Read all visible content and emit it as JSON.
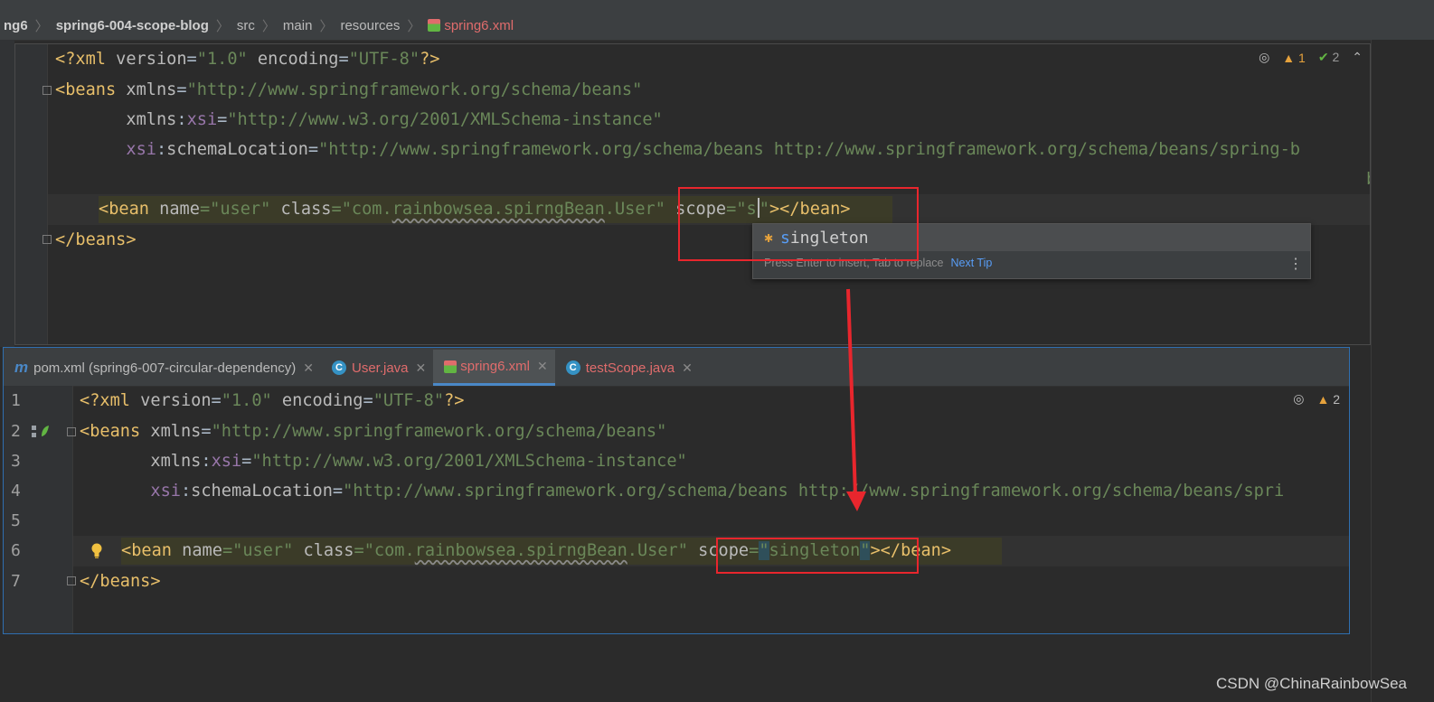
{
  "breadcrumb": {
    "items": [
      "ng6",
      "spring6-004-scope-blog",
      "src",
      "main",
      "resources",
      "spring6.xml"
    ]
  },
  "top_editor": {
    "lines": {
      "l1": {
        "pi_open": "<?xml ",
        "a1": "version",
        "eq1": "=",
        "v1": "\"1.0\"",
        "a2": " encoding",
        "eq2": "=",
        "v2": "\"UTF-8\"",
        "pi_close": "?>"
      },
      "l2": {
        "tag": "<beans ",
        "attr": "xmlns",
        "eq": "=",
        "val": "\"http://www.springframework.org/schema/beans\""
      },
      "l3": {
        "indent": "       ",
        "attr": "xmlns",
        "colon": ":",
        "ns": "xsi",
        "eq": "=",
        "val": "\"http://www.w3.org/2001/XMLSchema-instance\""
      },
      "l4": {
        "indent": "       ",
        "ns": "xsi",
        "colon": ":",
        "attr": "schemaLocation",
        "eq": "=",
        "val": "\"http://www.springframework.org/schema/beans http://www.springframework.org/schema/beans/spring-b"
      },
      "l6": {
        "tag": "<bean ",
        "a1": "name",
        "eq1": "=",
        "v1": "\"user\"",
        "a2": " class",
        "eq2": "=",
        "v2_pre": "\"com.",
        "v2_sq": "rainbowsea.spirngBean",
        "v2_post": ".User\"",
        "a3": " scope",
        "eq3": "=",
        "v3_open": "\"",
        "v3": "s",
        "v3_close": "\"",
        "close": "></bean>"
      },
      "l7": {
        "tag": "</beans>"
      }
    },
    "overflow_text": "bean",
    "status": {
      "warnings": "1",
      "checks": "2"
    }
  },
  "completion": {
    "match": "s",
    "rest": "ingleton",
    "hint": "Press Enter to insert, Tab to replace",
    "next_tip": "Next Tip"
  },
  "bottom_editor": {
    "tabs": [
      {
        "label": "pom.xml (spring6-007-circular-dependency)",
        "icon": "maven-icon"
      },
      {
        "label": "User.java",
        "icon": "class-icon"
      },
      {
        "label": "spring6.xml",
        "icon": "xml-file-icon"
      },
      {
        "label": "testScope.java",
        "icon": "class-icon"
      }
    ],
    "line_numbers": [
      "1",
      "2",
      "3",
      "4",
      "5",
      "6",
      "7"
    ],
    "lines": {
      "l1": {
        "pi_open": "<?xml ",
        "a1": "version",
        "eq1": "=",
        "v1": "\"1.0\"",
        "a2": " encoding",
        "eq2": "=",
        "v2": "\"UTF-8\"",
        "pi_close": "?>"
      },
      "l2": {
        "tag": "<beans ",
        "attr": "xmlns",
        "eq": "=",
        "val": "\"http://www.springframework.org/schema/beans\""
      },
      "l3": {
        "indent": "       ",
        "attr": "xmlns",
        "colon": ":",
        "ns": "xsi",
        "eq": "=",
        "val": "\"http://www.w3.org/2001/XMLSchema-instance\""
      },
      "l4": {
        "indent": "       ",
        "ns": "xsi",
        "colon": ":",
        "attr": "schemaLocation",
        "eq": "=",
        "val": "\"http://www.springframework.org/schema/beans http://www.springframework.org/schema/beans/spri"
      },
      "l6": {
        "tag": "<bean ",
        "a1": "name",
        "eq1": "=",
        "v1": "\"user\"",
        "a2": " class",
        "eq2": "=",
        "v2_pre": "\"com.",
        "v2_sq": "rainbowsea.spirngBean",
        "v2_post": ".User\"",
        "a3": " scope",
        "eq3": "=",
        "v3_open": "\"",
        "v3": "singleton",
        "v3_close": "\"",
        "close": "></bean>"
      },
      "l7": {
        "tag": "</beans>"
      }
    },
    "status": {
      "warnings": "2"
    }
  },
  "colors": {
    "annotation_red": "#e8262d",
    "accent_blue": "#4a88c7"
  },
  "watermark": "CSDN @ChinaRainbowSea"
}
